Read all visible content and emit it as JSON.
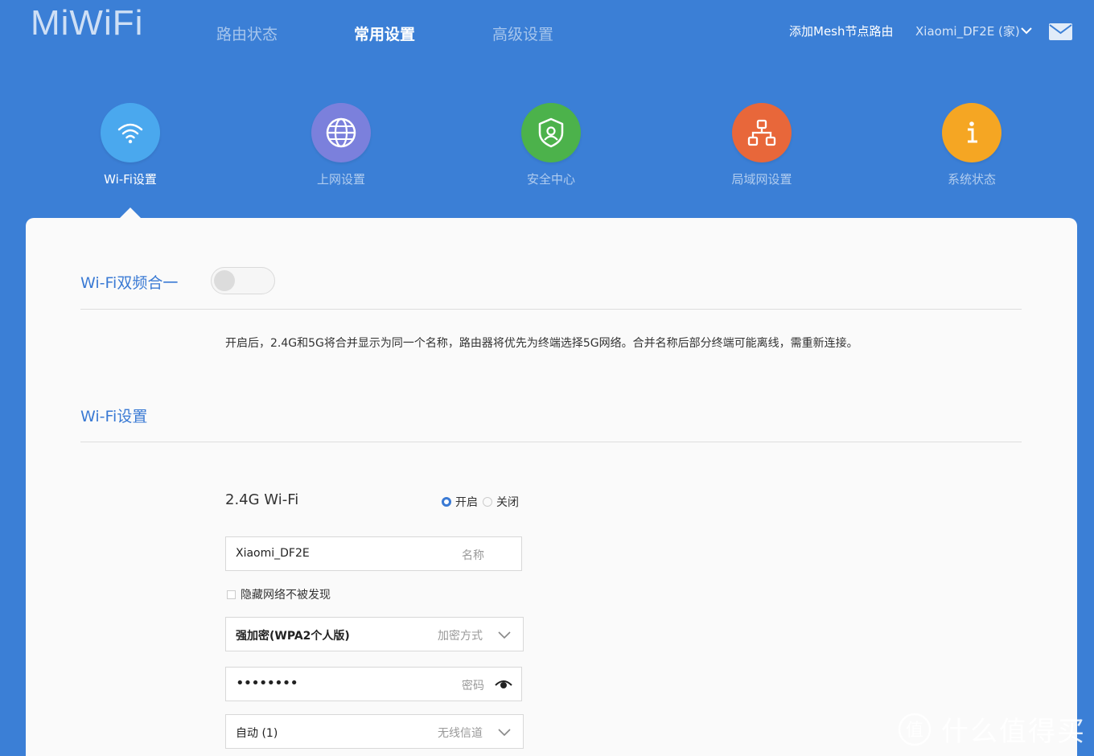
{
  "header": {
    "logo": "MiWiFi",
    "nav": [
      "路由状态",
      "常用设置",
      "高级设置"
    ],
    "add_mesh": "添加Mesh节点路由",
    "router_name": "Xiaomi_DF2E (家)",
    "mail_icon": "mail-icon",
    "accent": "#3b7fd6"
  },
  "features": [
    {
      "label": "Wi-Fi设置",
      "icon": "wifi-icon",
      "color": "#4aa8ee"
    },
    {
      "label": "上网设置",
      "icon": "globe-icon",
      "color": "#7b80dc"
    },
    {
      "label": "安全中心",
      "icon": "shield-icon",
      "color": "#4cb24b"
    },
    {
      "label": "局域网设置",
      "icon": "network-icon",
      "color": "#e8673a"
    },
    {
      "label": "系统状态",
      "icon": "info-icon",
      "color": "#f5a623"
    }
  ],
  "dual_band": {
    "title": "Wi-Fi双频合一",
    "enabled": false,
    "description": "开启后，2.4G和5G将合并显示为同一个名称，路由器将优先为终端选择5G网络。合并名称后部分终端可能离线，需重新连接。"
  },
  "wifi_settings": {
    "title": "Wi-Fi设置",
    "band_title": "2.4G Wi-Fi",
    "on_label": "开启",
    "off_label": "关闭",
    "state": "on",
    "ssid": "Xiaomi_DF2E",
    "ssid_hint": "名称",
    "hide_label": "隐藏网络不被发现",
    "encryption": "强加密(WPA2个人版)",
    "encryption_hint": "加密方式",
    "password": "••••••••",
    "password_hint": "密码",
    "channel": "自动 (1)",
    "channel_hint": "无线信道"
  },
  "watermark": "什么值得买"
}
